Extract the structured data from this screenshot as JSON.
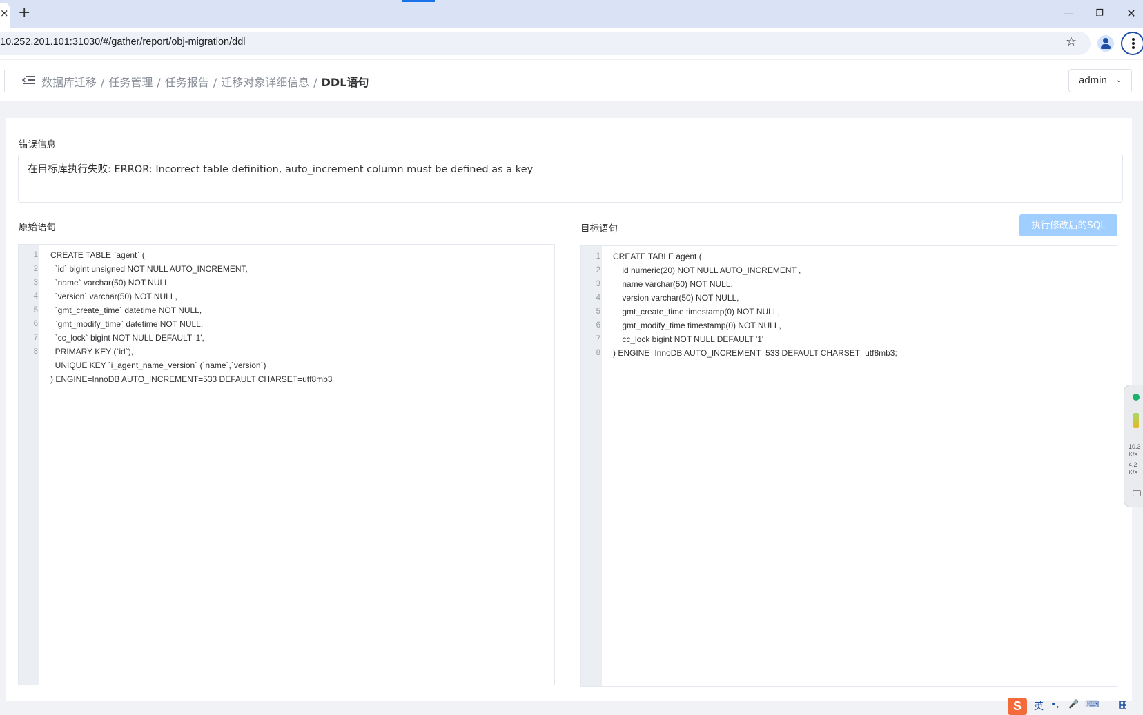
{
  "browser": {
    "url": "10.252.201.101:31030/#/gather/report/obj-migration/ddl",
    "tab_close": "×",
    "new_tab": "+",
    "minimize": "—",
    "restore": "❐",
    "close": "✕",
    "star": "☆"
  },
  "header": {
    "breadcrumb": [
      "数据库迁移",
      "任务管理",
      "任务报告",
      "迁移对象详细信息"
    ],
    "breadcrumb_current": "DDL语句",
    "separator": "/",
    "user": "admin",
    "user_chevron": "⌄"
  },
  "error": {
    "label": "错误信息",
    "message": "在目标库执行失败: ERROR: Incorrect table definition, auto_increment column must be defined as a key"
  },
  "source": {
    "label": "原始语句",
    "line_numbers": [
      "1",
      "2",
      "3",
      "4",
      "5",
      "6",
      "7",
      "8"
    ],
    "lines": [
      "CREATE TABLE `agent` (",
      "  `id` bigint unsigned NOT NULL AUTO_INCREMENT,",
      "  `name` varchar(50) NOT NULL,",
      "  `version` varchar(50) NOT NULL,",
      "  `gmt_create_time` datetime NOT NULL,",
      "  `gmt_modify_time` datetime NOT NULL,",
      "  `cc_lock` bigint NOT NULL DEFAULT '1',",
      "  PRIMARY KEY (`id`),",
      "  UNIQUE KEY `i_agent_name_version` (`name`,`version`)",
      ") ENGINE=InnoDB AUTO_INCREMENT=533 DEFAULT CHARSET=utf8mb3"
    ]
  },
  "target": {
    "label": "目标语句",
    "execute_button": "执行修改后的SQL",
    "line_numbers": [
      "1",
      "2",
      "3",
      "4",
      "5",
      "6",
      "7",
      "8"
    ],
    "lines": [
      "CREATE TABLE agent (",
      "    id numeric(20) NOT NULL AUTO_INCREMENT ,",
      "    name varchar(50) NOT NULL,",
      "    version varchar(50) NOT NULL,",
      "    gmt_create_time timestamp(0) NOT NULL,",
      "    gmt_modify_time timestamp(0) NOT NULL,",
      "    cc_lock bigint NOT NULL DEFAULT '1'",
      ") ENGINE=InnoDB AUTO_INCREMENT=533 DEFAULT CHARSET=utf8mb3;"
    ]
  },
  "widget": {
    "up": "10.3",
    "up_unit": "K/s",
    "down": "4.2",
    "down_unit": "K/s"
  },
  "ime": {
    "logo": "S",
    "lang": "英",
    "punct": "•,",
    "mic": "🎤",
    "keyboard": "⌨",
    "apps": "▦"
  }
}
